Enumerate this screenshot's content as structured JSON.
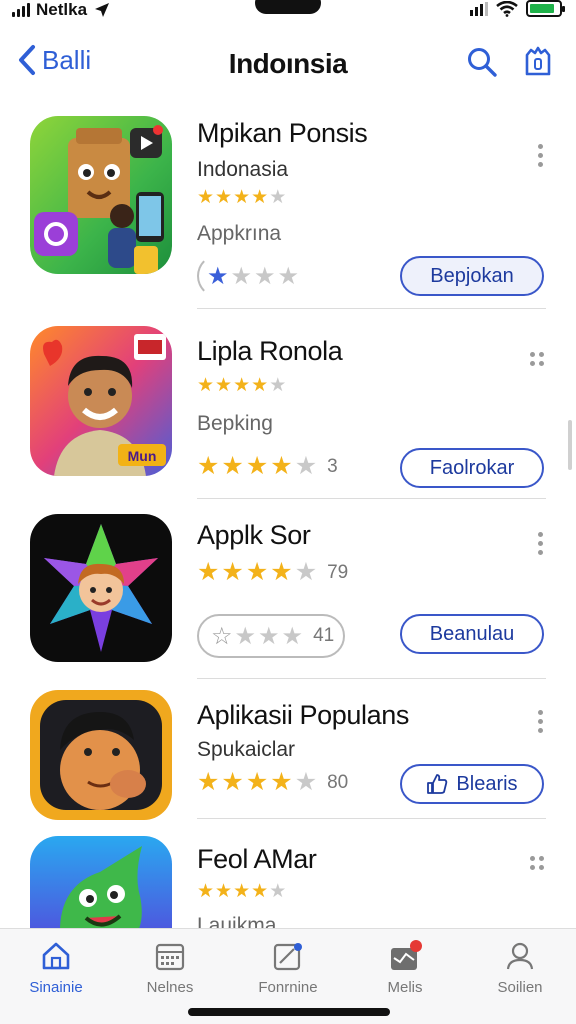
{
  "status_bar": {
    "carrier": "Netlka",
    "battery_level": 0.85
  },
  "header": {
    "back_label": "Balli",
    "title": "Indoınsia"
  },
  "apps": [
    {
      "name": "Mpikan Ponsis",
      "subtitle": "Indonasia",
      "rating": 4.5,
      "category": "Appkrına",
      "action_label": "Bepjokan",
      "user_rating": 1,
      "more_style": "vertical"
    },
    {
      "name": "Lipla Ronola",
      "rating": 4,
      "category": "Bepking",
      "rating_count": "3",
      "action_label": "Faolrokar",
      "more_style": "grid",
      "icon_badge": "Mun"
    },
    {
      "name": "Applk Sor",
      "rating_count": "79",
      "user_rating_count": "41",
      "action_label": "Beanulau",
      "more_style": "vertical"
    },
    {
      "name": "Aplikasii Populans",
      "subtitle": "Spukaiclar",
      "rating_count": "80",
      "action_label": "Blearis",
      "more_style": "vertical"
    },
    {
      "name": "Feol AMar",
      "rating": 4,
      "category": "Lauikma",
      "more_style": "grid"
    }
  ],
  "tab_bar": {
    "tabs": [
      {
        "label": "Sinainie",
        "icon": "home-icon",
        "active": true
      },
      {
        "label": "Nelnes",
        "icon": "calendar-icon",
        "active": false
      },
      {
        "label": "Fonrnine",
        "icon": "edit-icon",
        "active": false
      },
      {
        "label": "Melis",
        "icon": "mail-icon",
        "active": false,
        "badge": true
      },
      {
        "label": "Soilien",
        "icon": "person-icon",
        "active": false
      }
    ]
  },
  "colors": {
    "accent": "#2f5fd6",
    "star": "#f3b21a",
    "button_border": "#3a57c9"
  }
}
